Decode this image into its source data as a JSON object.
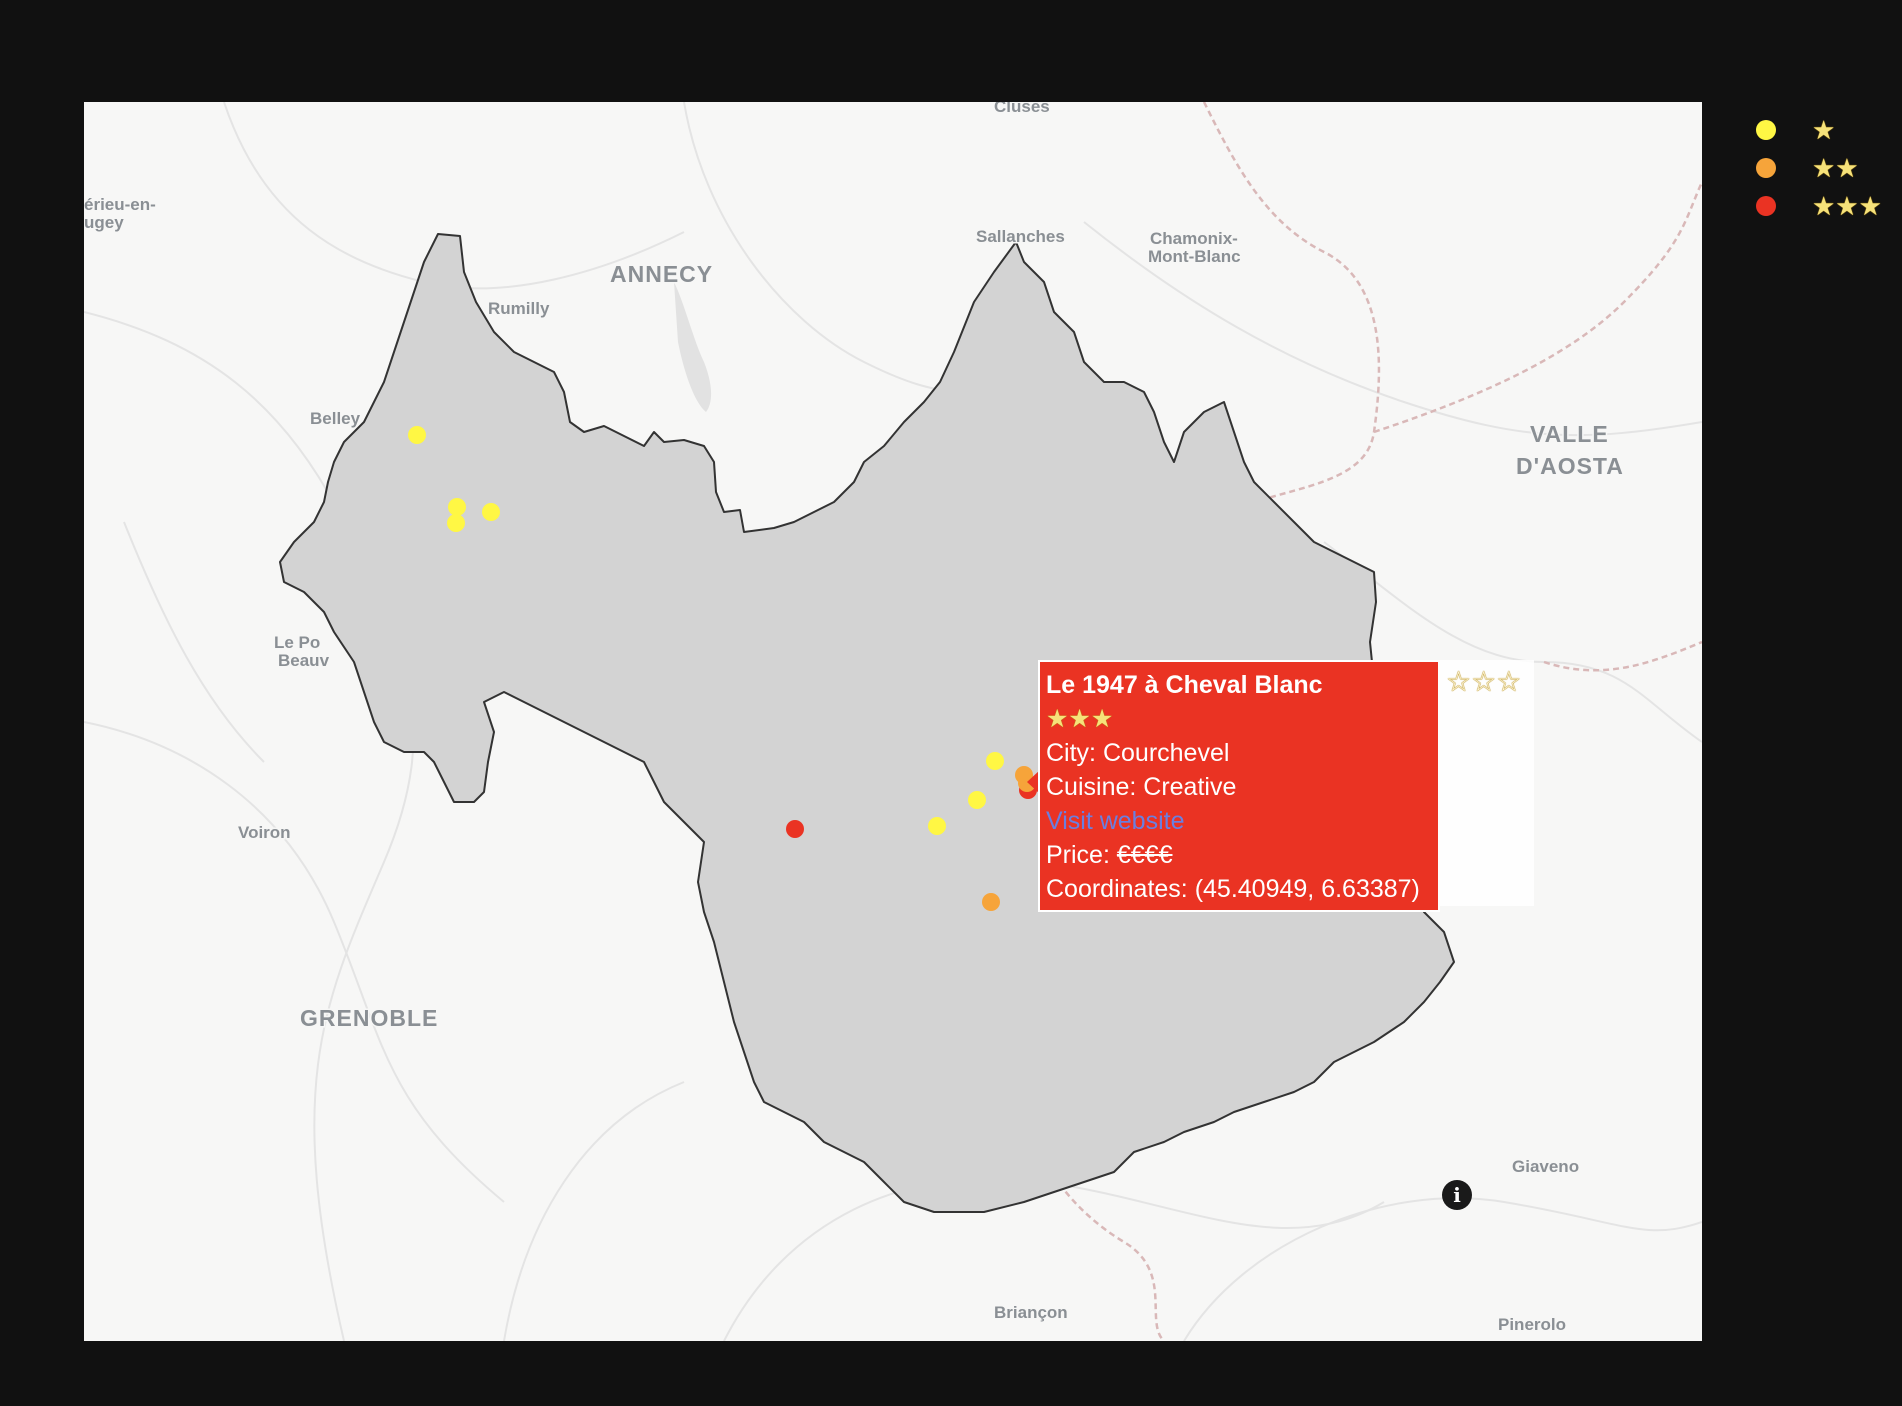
{
  "map": {
    "region_fill": "#d3d3d3",
    "region_border": "#333333",
    "background": "#f7f7f6",
    "places": [
      {
        "name": "Cluses",
        "size": "small"
      },
      {
        "name": "érieu-en-",
        "size": "small"
      },
      {
        "name": "ugey",
        "size": "small"
      },
      {
        "name": "Sallanches",
        "size": "small"
      },
      {
        "name": "Chamonix-",
        "size": "small"
      },
      {
        "name": "Mont-Blanc",
        "size": "small"
      },
      {
        "name": "ANNECY",
        "size": "big"
      },
      {
        "name": "Rumilly",
        "size": "small"
      },
      {
        "name": "Belley",
        "size": "small"
      },
      {
        "name": "VALLE",
        "size": "big"
      },
      {
        "name": "D'AOSTA",
        "size": "big"
      },
      {
        "name": "Le Po",
        "size": "small"
      },
      {
        "name": "Beauv",
        "size": "small"
      },
      {
        "name": "Voiron",
        "size": "small"
      },
      {
        "name": "GRENOBLE",
        "size": "big"
      },
      {
        "name": "Giaveno",
        "size": "small"
      },
      {
        "name": "Briançon",
        "size": "small"
      },
      {
        "name": "Pinerolo",
        "size": "small"
      }
    ],
    "markers": [
      {
        "stars": 2
      },
      {
        "stars": 1
      },
      {
        "stars": 1
      },
      {
        "stars": 1
      },
      {
        "stars": 1
      },
      {
        "stars": 1
      },
      {
        "stars": 1
      },
      {
        "stars": 3
      },
      {
        "stars": 1
      },
      {
        "stars": 2
      },
      {
        "stars": 2
      },
      {
        "stars": 3
      }
    ],
    "colors": {
      "1": "#fff744",
      "2": "#f6a43a",
      "3": "#ea3323"
    }
  },
  "tooltip": {
    "name": "Le 1947 à Cheval Blanc",
    "stars": "★★★",
    "city_label": "City: ",
    "city": "Courchevel",
    "cuisine_label": "Cuisine: ",
    "cuisine": "Creative",
    "link": "Visit website",
    "price_label": "Price: ",
    "price": "€€€€",
    "coords_label": "Coordinates: ",
    "coords": "(45.40949, 6.63387)",
    "side_stars": "☆☆☆"
  },
  "legend": {
    "items": [
      {
        "stars": "★",
        "color": "#fff744"
      },
      {
        "stars": "★★",
        "color": "#f6a43a"
      },
      {
        "stars": "★★★",
        "color": "#ea3323"
      }
    ]
  },
  "info_icon": "i"
}
